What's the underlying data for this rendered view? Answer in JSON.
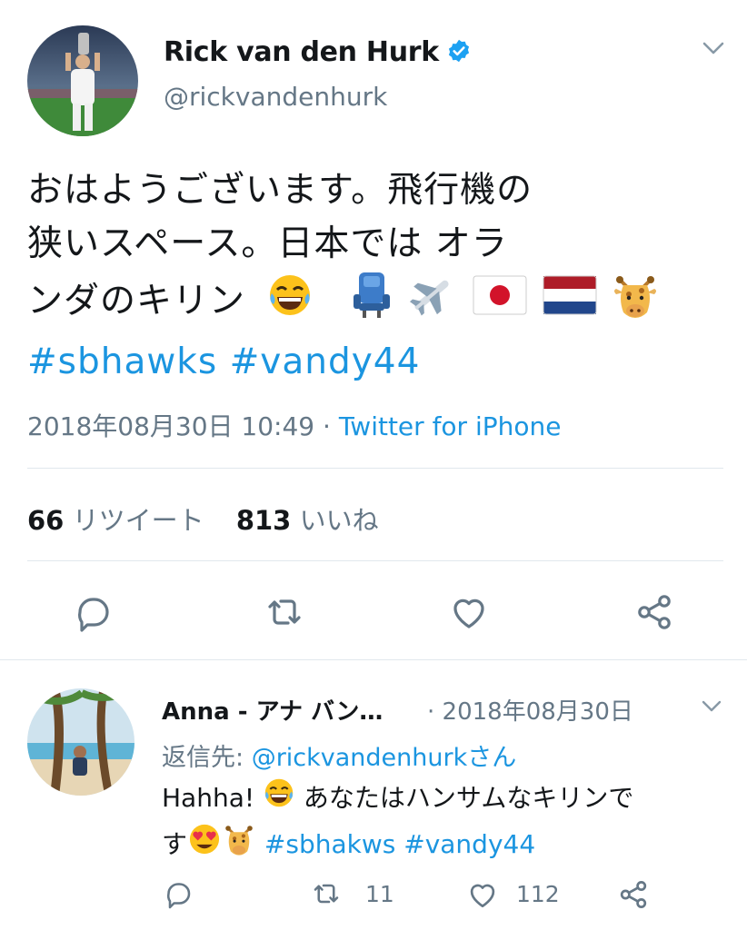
{
  "tweet": {
    "author_name": "Rick van den Hurk",
    "handle": "@rickvandenhurk",
    "text_line1": "おはようございます。飛行機の",
    "text_line2": "狭いスペース。日本では オラ",
    "text_line3": "ンダのキリン",
    "hashtags": "#sbhawks #vandy44",
    "timestamp": "2018年08月30日 10:49",
    "separator": "·",
    "source": "Twitter for iPhone",
    "retweet_count": "66",
    "retweet_label": "リツイート",
    "like_count": "813",
    "like_label": "いいね"
  },
  "reply": {
    "author_name": "Anna - アナ バン…",
    "date": "· 2018年08月30日",
    "reply_prefix": "返信先: ",
    "reply_to": "@rickvandenhurkさん",
    "text_part1": "Hahha! ",
    "text_part2": " あなたはハンサムなキリンで",
    "text_part3": "す",
    "hashtags": " #sbhakws #vandy44",
    "retweet_count": "11",
    "like_count": "112"
  },
  "icons": {
    "verified": "verified-badge-icon",
    "dropdown": "chevron-down-icon",
    "reply": "reply-icon",
    "retweet": "retweet-icon",
    "like": "heart-icon",
    "share": "share-icon"
  },
  "colors": {
    "link": "#1b95e0",
    "secondary_text": "#657786",
    "divider": "#e1e8ed"
  }
}
